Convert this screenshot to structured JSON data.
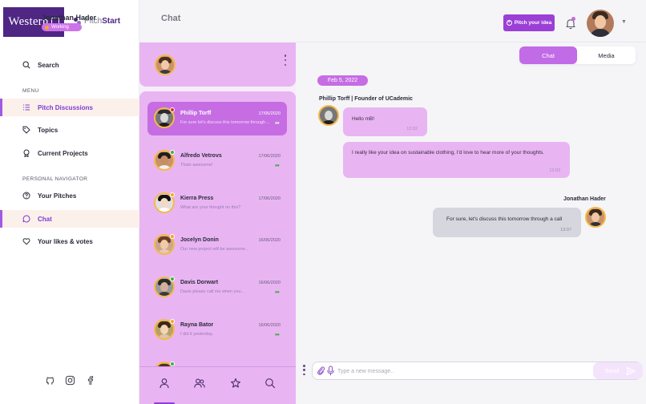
{
  "brand": {
    "university": "Western",
    "product_part1": "Pitch",
    "product_part2": "Start"
  },
  "header": {
    "page_title": "Chat",
    "pitch_button": "Pitch your idea",
    "accent": "#9b3fd6"
  },
  "sidebar": {
    "search": "Search",
    "menu_heading": "MENU",
    "menu_items": [
      {
        "label": "Pitch Discussions",
        "icon": "list-icon",
        "active": true
      },
      {
        "label": "Topics",
        "icon": "tag-icon",
        "active": false
      },
      {
        "label": "Current Projects",
        "icon": "award-icon",
        "active": false
      }
    ],
    "personal_heading": "PERSONAL NAVIGATOR",
    "personal_items": [
      {
        "label": "Your Pitches",
        "icon": "question-circle-icon",
        "active": false
      },
      {
        "label": "Chat",
        "icon": "chat-bubble-icon",
        "active": true
      },
      {
        "label": "Your likes & votes",
        "icon": "heart-icon",
        "active": false
      }
    ],
    "social": [
      "github-icon",
      "instagram-icon",
      "facebook-icon"
    ]
  },
  "current_user": {
    "name": "Jonathan Hader",
    "status": "Working"
  },
  "chat_list": [
    {
      "name": "Phillip Torff",
      "time": "17/06/2020",
      "preview": "For sure let's discuss this tomorrow through a call",
      "status_color": "#d93025",
      "selected": true,
      "read": false
    },
    {
      "name": "Alfredo Vetrovs",
      "time": "17/06/2020",
      "preview": "Thats awesome!",
      "status_color": "#3fae49",
      "selected": false,
      "read": true
    },
    {
      "name": "Kierra Press",
      "time": "17/06/2020",
      "preview": "What are your thought on this?",
      "status_color": "#f5a623",
      "selected": false,
      "read": false
    },
    {
      "name": "Jocelyn Donin",
      "time": "16/06/2020",
      "preview": "Our new project will be awesome...",
      "status_color": "#f5a623",
      "selected": false,
      "read": false
    },
    {
      "name": "Davis Dorwart",
      "time": "16/06/2020",
      "preview": "Davis please call me when you...",
      "status_color": "#3fae49",
      "selected": false,
      "read": true
    },
    {
      "name": "Rayna Bator",
      "time": "16/06/2020",
      "preview": "I did it yesterday.",
      "status_color": "#f5a623",
      "selected": false,
      "read": true
    }
  ],
  "list_tabs": [
    "person-icon",
    "people-icon",
    "star-icon",
    "search-icon"
  ],
  "conversation": {
    "tabs": [
      "Chat",
      "Media"
    ],
    "date": "Feb 5, 2022",
    "sender_label": "Phillip Torff | Founder of UCademic",
    "messages": [
      {
        "text": "Hello mB!",
        "time": "13:02"
      },
      {
        "text": "I really like your idea on sustainable clothing, I'd love to hear more of your thoughts.",
        "time": "13:03"
      }
    ],
    "reply_name": "Jonathan Hader",
    "reply": {
      "text": "For sure, let's discuss this tomorrow through a call",
      "time": "13:07"
    }
  },
  "composer": {
    "placeholder": "Type a new message..",
    "send_label": "Send"
  }
}
